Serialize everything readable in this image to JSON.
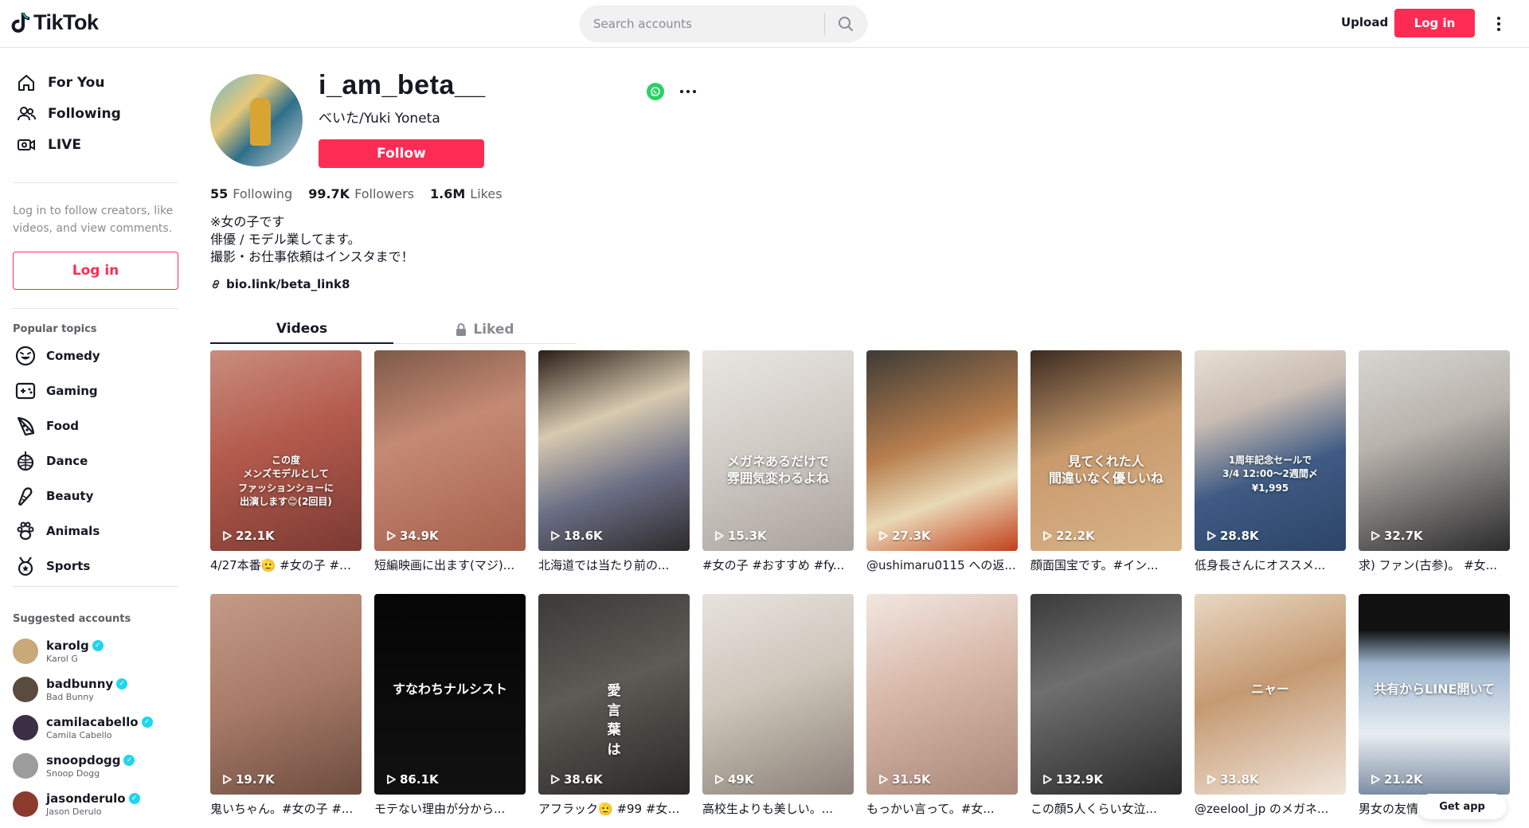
{
  "header": {
    "logo_text": "TikTok",
    "search_placeholder": "Search accounts",
    "upload_label": "Upload",
    "login_label": "Log in"
  },
  "sidebar": {
    "nav": [
      {
        "label": "For You",
        "icon": "home-icon"
      },
      {
        "label": "Following",
        "icon": "people-icon"
      },
      {
        "label": "LIVE",
        "icon": "live-icon"
      }
    ],
    "login_note": "Log in to follow creators, like videos, and view comments.",
    "login_label": "Log in",
    "popular_title": "Popular topics",
    "topics": [
      {
        "label": "Comedy",
        "icon": "laugh-icon"
      },
      {
        "label": "Gaming",
        "icon": "gamepad-icon"
      },
      {
        "label": "Food",
        "icon": "pizza-icon"
      },
      {
        "label": "Dance",
        "icon": "disco-ball-icon"
      },
      {
        "label": "Beauty",
        "icon": "brush-icon"
      },
      {
        "label": "Animals",
        "icon": "paw-icon"
      },
      {
        "label": "Sports",
        "icon": "trophy-icon"
      }
    ],
    "suggested_title": "Suggested accounts",
    "accounts": [
      {
        "handle": "karolg",
        "name": "Karol G",
        "color": "#c9a97a"
      },
      {
        "handle": "badbunny",
        "name": "Bad Bunny",
        "color": "#5b4a3e"
      },
      {
        "handle": "camilacabello",
        "name": "Camila Cabello",
        "color": "#3a2f45"
      },
      {
        "handle": "snoopdogg",
        "name": "Snoop Dogg",
        "color": "#9c9c9c"
      },
      {
        "handle": "jasonderulo",
        "name": "Jason Derulo",
        "color": "#8a3b2e"
      }
    ]
  },
  "profile": {
    "username": "i_am_beta__",
    "display_name": "べいた/Yuki Yoneta",
    "follow_label": "Follow",
    "following_count": "55",
    "following_label": "Following",
    "followers_count": "99.7K",
    "followers_label": "Followers",
    "likes_count": "1.6M",
    "likes_label": "Likes",
    "bio_lines": [
      "※女の子です",
      "俳優 / モデル業してます。",
      "撮影・お仕事依頼はインスタまで！"
    ],
    "link": "bio.link/beta_link8"
  },
  "tabs": {
    "videos": "Videos",
    "liked": "Liked"
  },
  "videos": [
    {
      "views": "22.1K",
      "caption": "4/27本番🫡 #女の子 #ボ...",
      "overlay": "この度\nメンズモデルとして\nファッションショーに\n出演します😊(2回目)",
      "bg": "linear-gradient(160deg,#c98d7d 0%,#b35a4c 45%,#7b3a33 100%)"
    },
    {
      "views": "34.9K",
      "caption": "短編映画に出ます(マジ)...",
      "overlay": "",
      "bg": "linear-gradient(160deg,#7d5a48 0%,#c58a74 40%,#a5604c 100%)"
    },
    {
      "views": "18.6K",
      "caption": "北海道では当たり前の...",
      "overlay": "",
      "bg": "linear-gradient(160deg,#2a1e17 0%,#d8cab0 35%,#6b6f86 65%,#2d2a2a 100%)"
    },
    {
      "views": "15.3K",
      "caption": "#女の子 #おすすめ #fy...",
      "overlay": "メガネあるだけで\n雰囲気変わるよね",
      "bg": "linear-gradient(160deg,#e9e6e2 0%,#cfc9c3 50%,#a9a29c 100%)"
    },
    {
      "views": "27.3K",
      "caption": "@ushimaru0115 への返...",
      "overlay": "",
      "bg": "linear-gradient(160deg,#3e3b36 0%,#b87f4f 45%,#e9d9b6 70%,#c2401c 100%)"
    },
    {
      "views": "22.2K",
      "caption": "顔面国宝です。#イン...",
      "overlay": "見てくれた人\n間違いなく優しいね",
      "bg": "linear-gradient(160deg,#3a2b21 0%,#c89a6c 45%,#d9b48a 100%)"
    },
    {
      "views": "28.8K",
      "caption": "低身長さんにオススメ...",
      "overlay": "1周年記念セールで\n3/4 12:00〜2週間〆\n¥1,995",
      "bg": "linear-gradient(160deg,#e8dfd5 0%,#c9bcb2 30%,#3f5b84 60%,#2c4467 100%)"
    },
    {
      "views": "32.7K",
      "caption": "求) ファン(古参)。 #女...",
      "overlay": "",
      "bg": "linear-gradient(160deg,#d8d6d2 0%,#b9b3ad 40%,#2a2a2c 100%)"
    },
    {
      "views": "19.7K",
      "caption": "鬼いちゃん。#女の子 #...",
      "overlay": "",
      "bg": "linear-gradient(160deg,#c49b86 0%,#a77a67 50%,#6d4d40 100%)"
    },
    {
      "views": "86.1K",
      "caption": "モテない理由が分から...",
      "overlay": "すなわちナルシスト",
      "bg": "linear-gradient(180deg,#050505 0%,#111 100%)"
    },
    {
      "views": "38.6K",
      "caption": "アフラック🫡 #99 #女の...",
      "overlay": "愛\n言\n葉\nは",
      "bg": "linear-gradient(160deg,#3b3a38 0%,#5e5a55 45%,#2b2927 100%)"
    },
    {
      "views": "49K",
      "caption": "高校生よりも美しい。...",
      "overlay": "",
      "bg": "linear-gradient(160deg,#e7e3dd 0%,#cfc6bc 45%,#8b8178 100%)"
    },
    {
      "views": "31.5K",
      "caption": "もっかい言って。#女...",
      "overlay": "",
      "bg": "linear-gradient(160deg,#f1e7e1 0%,#d7b7a7 45%,#a9877a 100%)"
    },
    {
      "views": "132.9K",
      "caption": "この顔5人くらい女泣...",
      "overlay": "",
      "bg": "linear-gradient(160deg,#3a3a3a 0%,#6f6f6f 40%,#2a2a2a 100%)"
    },
    {
      "views": "33.8K",
      "caption": "@zeelool_jp のメガネ...",
      "overlay": "ニャー",
      "bg": "linear-gradient(160deg,#e8d7c2 0%,#c59a72 45%,#f0e6dc 100%)"
    },
    {
      "views": "21.2K",
      "caption": "男女の友情っ...",
      "overlay": "共有からLINE開いて",
      "bg": "linear-gradient(180deg,#111 0%,#111 18%,#9fb6cf 35%,#e8edf2 70%,#7d8ea3 100%)"
    }
  ],
  "get_app_label": "Get app",
  "colors": {
    "brand": "#fe2c55",
    "verified": "#20d5ec"
  }
}
